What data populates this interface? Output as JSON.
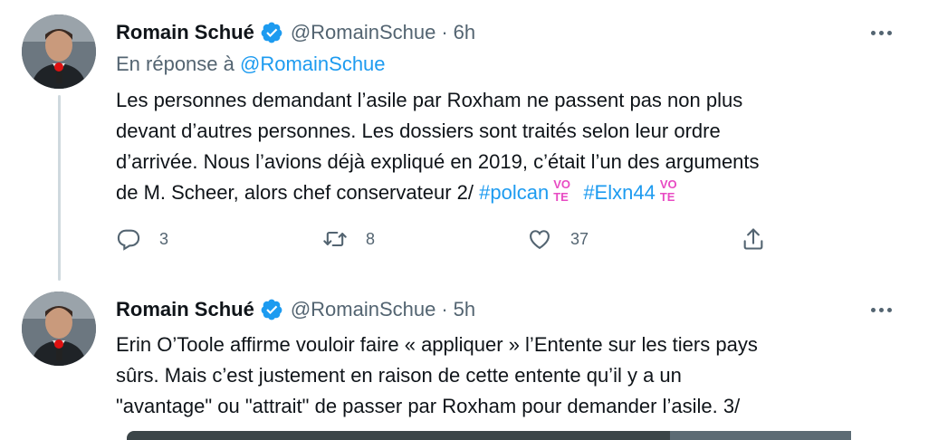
{
  "tweets": [
    {
      "author": {
        "name": "Romain Schué",
        "handle": "@RomainSchue",
        "time": "6h"
      },
      "reply_to": {
        "prefix": "En réponse à",
        "mention": "@RomainSchue"
      },
      "lines": [
        "Les personnes demandant l’asile par Roxham ne passent pas non plus",
        "devant d’autres personnes. Les dossiers sont traités selon leur ordre",
        "d’arrivée. Nous l’avions déjà expliqué en 2019, c’était l’un des arguments"
      ],
      "last_line_text": "de M. Scheer, alors chef conservateur 2/",
      "hashtags": [
        "#polcan",
        "#Elxn44"
      ],
      "vote_badge": [
        "VO",
        "TE"
      ],
      "counts": {
        "replies": "3",
        "retweets": "8",
        "likes": "37"
      }
    },
    {
      "author": {
        "name": "Romain Schué",
        "handle": "@RomainSchue",
        "time": "5h"
      },
      "lines": [
        "Erin O’Toole affirme vouloir faire « appliquer » l’Entente sur les tiers pays",
        "sûrs. Mais c’est justement en raison de cette entente qu’il y a un",
        "\"avantage\" ou \"attrait\" de passer par Roxham pour demander l’asile. 3/"
      ]
    }
  ],
  "icons": {
    "verified": "verified-badge-icon",
    "more": "more-options-icon",
    "reply": "reply-icon",
    "retweet": "retweet-icon",
    "like": "heart-icon",
    "share": "share-icon"
  },
  "colors": {
    "accent": "#1d9bf0",
    "secondary": "#536471",
    "text": "#0f1419"
  }
}
